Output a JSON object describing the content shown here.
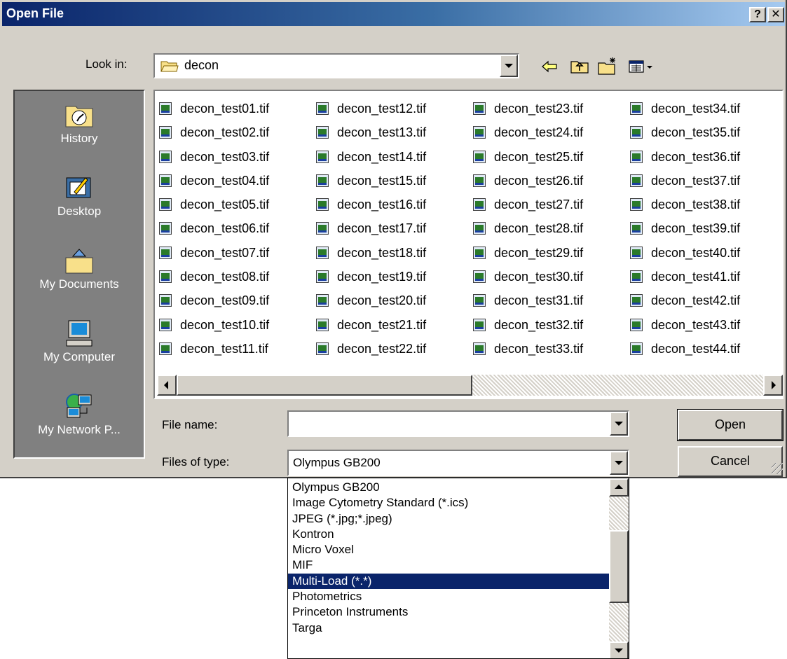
{
  "window": {
    "title": "Open File",
    "help_label": "?",
    "close_label": "✕"
  },
  "look_in": {
    "label": "Look in:",
    "value": "decon"
  },
  "toolbar": {
    "back_icon": "back-arrow-icon",
    "up_icon": "up-folder-icon",
    "new_folder_icon": "new-folder-icon",
    "view_menu_icon": "view-menu-icon"
  },
  "places": [
    {
      "label": "History",
      "icon": "history-icon"
    },
    {
      "label": "Desktop",
      "icon": "desktop-icon"
    },
    {
      "label": "My Documents",
      "icon": "my-documents-icon"
    },
    {
      "label": "My Computer",
      "icon": "my-computer-icon"
    },
    {
      "label": "My Network P...",
      "icon": "my-network-places-icon"
    }
  ],
  "files": [
    [
      "decon_test01.tif",
      "decon_test02.tif",
      "decon_test03.tif",
      "decon_test04.tif",
      "decon_test05.tif",
      "decon_test06.tif",
      "decon_test07.tif",
      "decon_test08.tif",
      "decon_test09.tif",
      "decon_test10.tif",
      "decon_test11.tif"
    ],
    [
      "decon_test12.tif",
      "decon_test13.tif",
      "decon_test14.tif",
      "decon_test15.tif",
      "decon_test16.tif",
      "decon_test17.tif",
      "decon_test18.tif",
      "decon_test19.tif",
      "decon_test20.tif",
      "decon_test21.tif",
      "decon_test22.tif"
    ],
    [
      "decon_test23.tif",
      "decon_test24.tif",
      "decon_test25.tif",
      "decon_test26.tif",
      "decon_test27.tif",
      "decon_test28.tif",
      "decon_test29.tif",
      "decon_test30.tif",
      "decon_test31.tif",
      "decon_test32.tif",
      "decon_test33.tif"
    ],
    [
      "decon_test34.tif",
      "decon_test35.tif",
      "decon_test36.tif",
      "decon_test37.tif",
      "decon_test38.tif",
      "decon_test39.tif",
      "decon_test40.tif",
      "decon_test41.tif",
      "decon_test42.tif",
      "decon_test43.tif",
      "decon_test44.tif"
    ]
  ],
  "file_name": {
    "label": "File name:",
    "value": ""
  },
  "file_type": {
    "label": "Files of type:",
    "value": "Olympus GB200",
    "options": [
      "Olympus GB200",
      "Image Cytometry Standard (*.ics)",
      "JPEG (*.jpg;*.jpeg)",
      "Kontron",
      "Micro Voxel",
      "MIF",
      "Multi-Load (*.*)",
      "Photometrics",
      "Princeton Instruments",
      "Targa"
    ],
    "highlighted_index": 6
  },
  "buttons": {
    "open": "Open",
    "cancel": "Cancel"
  },
  "colors": {
    "title_bar": "#0a246a",
    "face": "#d4d0c8",
    "selection": "#0a246a",
    "places_bar": "#808080"
  }
}
